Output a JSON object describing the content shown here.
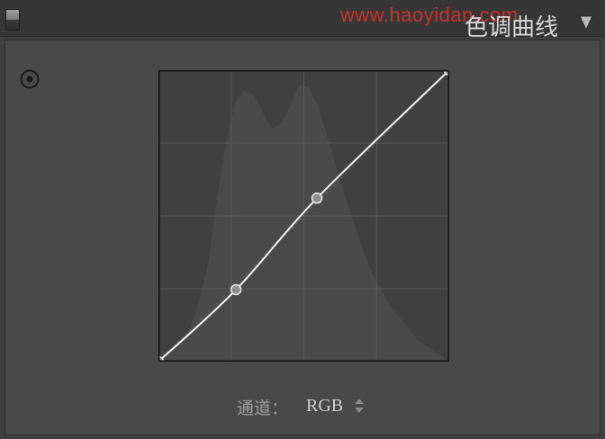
{
  "panel": {
    "title": "色调曲线",
    "watermark": "www.haoyidan.com"
  },
  "icons": {
    "panel_toggle": "panel-switch-icon",
    "collapse": "triangle-down-icon",
    "target_adjust": "target-adjust-icon",
    "channel_stepper": "up-down-arrows-icon"
  },
  "colors": {
    "watermark": "#c9322e",
    "graph_bg": "#404040",
    "curve": "#f2f2f2",
    "grid": "#5a5a5a"
  },
  "channel": {
    "label": "通道：",
    "value": "RGB"
  },
  "chart_data": {
    "type": "line",
    "xlim": [
      0,
      255
    ],
    "ylim": [
      0,
      255
    ],
    "grid": true,
    "grid_divisions": 4,
    "curve_points": [
      {
        "x": 0,
        "y": 0
      },
      {
        "x": 68,
        "y": 63
      },
      {
        "x": 139,
        "y": 143
      },
      {
        "x": 255,
        "y": 255
      }
    ],
    "histogram": [
      8,
      12,
      18,
      30,
      55,
      90,
      150,
      200,
      235,
      245,
      240,
      225,
      210,
      215,
      230,
      250,
      248,
      232,
      205,
      178,
      150,
      125,
      100,
      80,
      65,
      50,
      40,
      30,
      20,
      14,
      8,
      4
    ]
  }
}
